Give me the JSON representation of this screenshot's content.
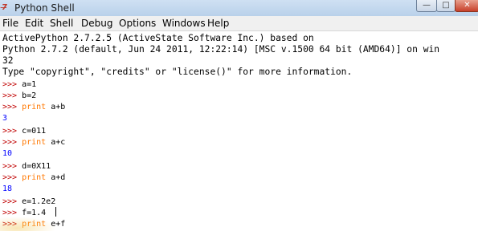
{
  "window": {
    "title": "Python Shell",
    "app_icon": "7̶",
    "controls": {
      "minimize": "—",
      "maximize": "□",
      "close": "✕"
    }
  },
  "menu": {
    "items": [
      {
        "label": "File"
      },
      {
        "label": "Edit"
      },
      {
        "label": "Shell"
      },
      {
        "label": "Debug"
      },
      {
        "label": "Options"
      },
      {
        "label": "Windows"
      },
      {
        "label": "Help"
      }
    ]
  },
  "shell": {
    "banner": [
      "ActivePython 2.7.2.5 (ActiveState Software Inc.) based on",
      "Python 2.7.2 (default, Jun 24 2011, 12:22:14) [MSC v.1500 64 bit (AMD64)] on win",
      "32",
      "Type \"copyright\", \"credits\" or \"license()\" for more information."
    ],
    "prompt": ">>>",
    "keyword_print": "print",
    "lines": [
      {
        "kind": "input",
        "text": " a=1"
      },
      {
        "kind": "input",
        "text": " b=2"
      },
      {
        "kind": "print",
        "text": " a+b"
      },
      {
        "kind": "output",
        "text": "3"
      },
      {
        "kind": "input",
        "text": " c=011"
      },
      {
        "kind": "print",
        "text": " a+c"
      },
      {
        "kind": "output",
        "text": "10"
      },
      {
        "kind": "input",
        "text": " d=0X11"
      },
      {
        "kind": "print",
        "text": " a+d"
      },
      {
        "kind": "output",
        "text": "18"
      },
      {
        "kind": "input",
        "text": " e=1.2e2"
      },
      {
        "kind": "input",
        "text": " f=1.4"
      },
      {
        "kind": "print",
        "text": " e+f"
      }
    ]
  }
}
